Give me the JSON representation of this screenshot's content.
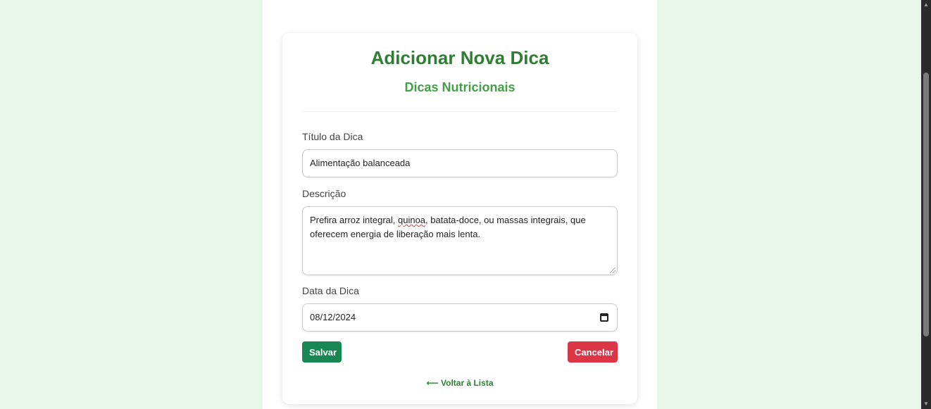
{
  "form": {
    "title": "Adicionar Nova Dica",
    "subtitle": "Dicas Nutricionais",
    "title_label": "Título da Dica",
    "title_value": "Alimentação balanceada",
    "description_label": "Descrição",
    "description_value_before": "Prefira arroz integral, ",
    "description_value_flagged": "quinoa",
    "description_value_after": ", batata-doce, ou massas integrais, que oferecem energia de liberação mais lenta.",
    "date_label": "Data da Dica",
    "date_value": "08/12/2024",
    "save_label": "Salvar",
    "cancel_label": "Cancelar",
    "back_label": "⟵ Voltar à Lista"
  },
  "colors": {
    "background": "#e8f5e9",
    "title": "#2e7d32",
    "subtitle": "#43a047",
    "save": "#198754",
    "cancel": "#dc3545"
  },
  "icons": {
    "date_picker": "calendar-icon",
    "resize": "resize-grip-icon"
  }
}
